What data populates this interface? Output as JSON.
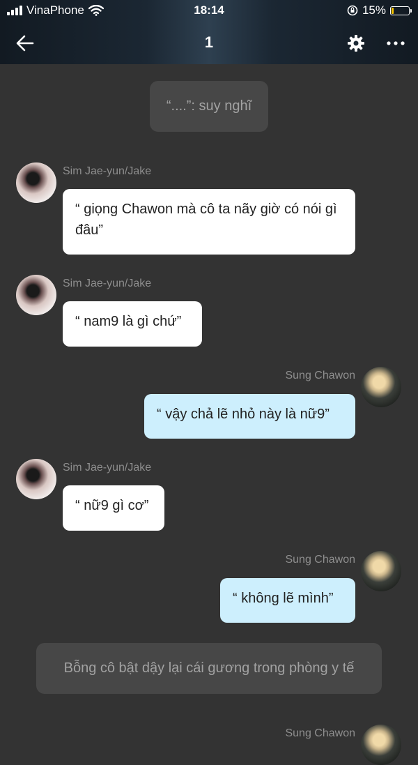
{
  "status_bar": {
    "carrier": "VinaPhone",
    "time": "18:14",
    "battery": "15%",
    "battery_level": 0.15
  },
  "header": {
    "title": "1",
    "back_icon": "arrow-left-icon",
    "settings_icon": "gear-icon",
    "more_icon": "ellipsis-icon"
  },
  "messages": [
    {
      "type": "narration",
      "text": "“....”: suy nghĩ"
    },
    {
      "type": "incoming",
      "sender": "Sim Jae-yun/Jake",
      "text": "“ giọng Chawon mà cô ta nãy giờ có nói gì đâu”"
    },
    {
      "type": "incoming",
      "sender": "Sim Jae-yun/Jake",
      "text": "“ nam9 là gì chứ”"
    },
    {
      "type": "outgoing",
      "sender": "Sung Chawon",
      "text": "“ vậy chả lẽ nhỏ này là nữ9”"
    },
    {
      "type": "incoming",
      "sender": "Sim Jae-yun/Jake",
      "text": "“ nữ9 gì cơ”"
    },
    {
      "type": "outgoing",
      "sender": "Sung Chawon",
      "text": "“ không lẽ mình”"
    },
    {
      "type": "narration",
      "text": "Bỗng cô bật dậy lại cái gương trong phòng y tế"
    },
    {
      "type": "outgoing",
      "sender": "Sung Chawon",
      "text": ""
    }
  ],
  "colors": {
    "background": "#333333",
    "incoming_bubble": "#ffffff",
    "outgoing_bubble": "#cdeffd",
    "narration_bubble": "#474747",
    "battery": "#f5c400"
  }
}
